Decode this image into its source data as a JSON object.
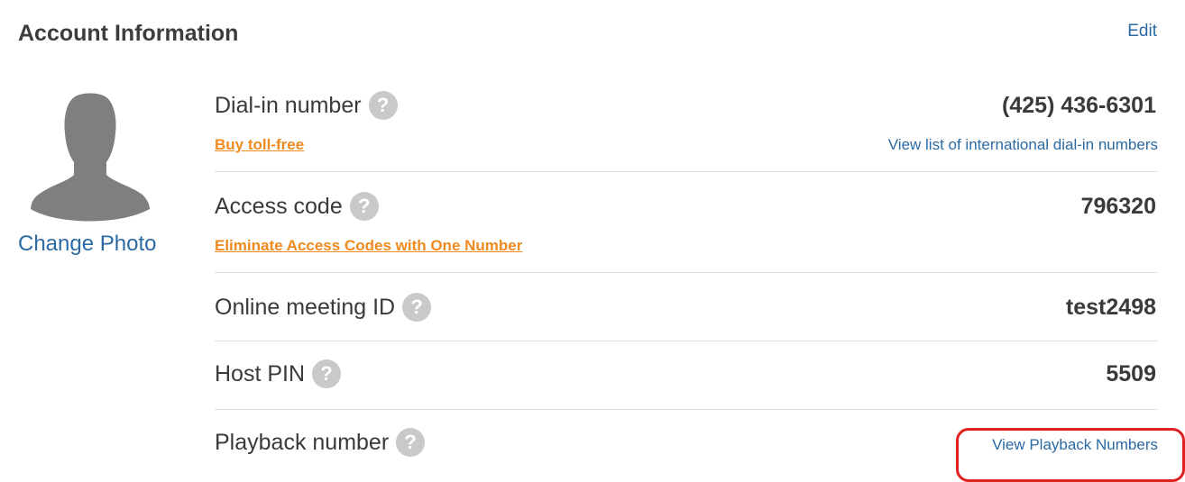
{
  "header": {
    "title": "Account Information",
    "edit_label": "Edit"
  },
  "profile": {
    "avatar_icon": "default-avatar-silhouette",
    "change_photo_label": "Change Photo"
  },
  "rows": {
    "dial_in": {
      "label": "Dial-in number",
      "value": "(425) 436-6301",
      "promo_link": "Buy toll-free",
      "secondary_link": "View list of international dial-in numbers"
    },
    "access_code": {
      "label": "Access code",
      "value": "796320",
      "promo_link": "Eliminate Access Codes with One Number"
    },
    "meeting_id": {
      "label": "Online meeting ID",
      "value": "test2498"
    },
    "host_pin": {
      "label": "Host PIN",
      "value": "5509"
    },
    "playback": {
      "label": "Playback number",
      "link": "View Playback Numbers"
    }
  },
  "help_icon_glyph": "?",
  "colors": {
    "link_blue": "#2b6aa3",
    "promo_orange": "#f08a1f",
    "highlight_red": "#e02020",
    "help_icon_gray": "#c9c9c9"
  }
}
